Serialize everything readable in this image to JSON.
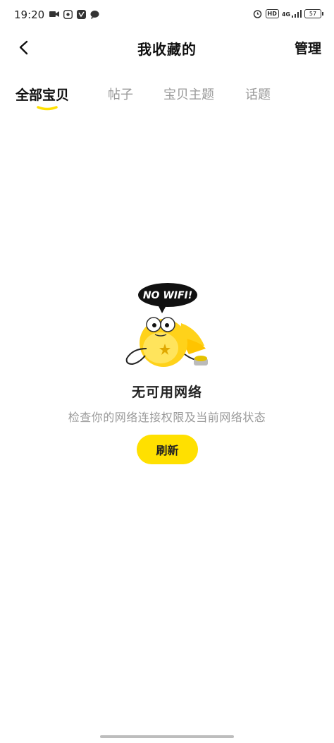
{
  "status_bar": {
    "time": "19:20",
    "left_icons": [
      "video-icon",
      "app-icon",
      "app-icon",
      "chat-icon"
    ],
    "right_icons": [
      "alarm-icon",
      "hd-icon",
      "signal-4g-icon",
      "battery-icon"
    ],
    "hd_label": "HD",
    "network_label": "4G",
    "battery_label": "57"
  },
  "header": {
    "title": "我收藏的",
    "manage_label": "管理"
  },
  "tabs": [
    {
      "label": "全部宝贝",
      "active": true
    },
    {
      "label": "帖子",
      "active": false
    },
    {
      "label": "宝贝主题",
      "active": false
    },
    {
      "label": "话题",
      "active": false
    }
  ],
  "empty_state": {
    "illustration_text": "NO WIFI!",
    "title": "无可用网络",
    "description": "检查你的网络连接权限及当前网络状态",
    "refresh_label": "刷新"
  },
  "colors": {
    "accent": "#ffe000",
    "text_primary": "#111111",
    "text_secondary": "#9a9a9a"
  }
}
